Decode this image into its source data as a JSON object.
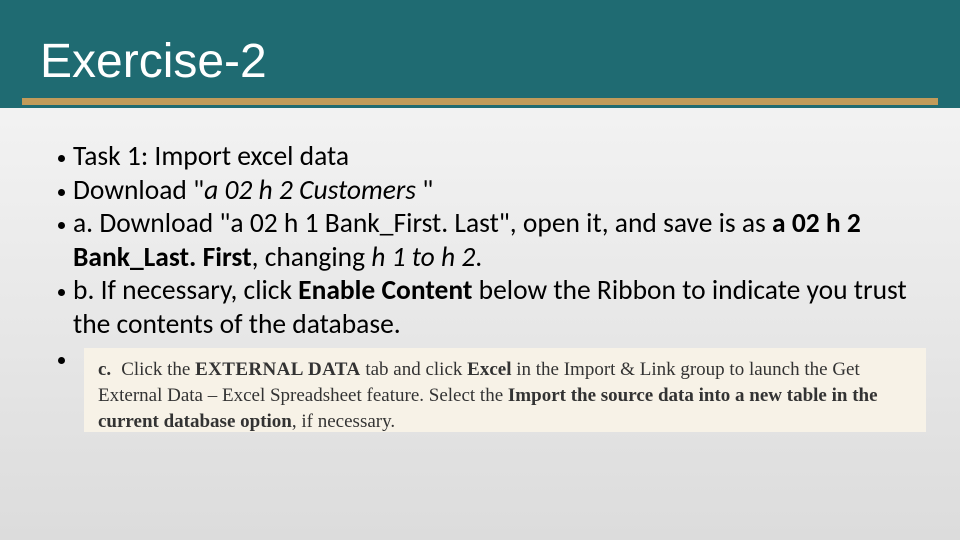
{
  "title": "Exercise-2",
  "bullets": {
    "b1": "Task 1: Import excel data",
    "b2_pre": "Download \"",
    "b2_italic": "a 02 h 2 Customers ",
    "b2_post": "\"",
    "b3_a": "a. Download \"a 02 h 1 Bank_First. Last\", open it, and save is as ",
    "b3_bold": "a 02 h 2 Bank_Last. First",
    "b3_mid": ", changing ",
    "b3_italic": "h 1 to h 2",
    "b3_end": ".",
    "b4_a": "b. If necessary, click ",
    "b4_bold": "Enable Content",
    "b4_b": " below the Ribbon to indicate you trust the contents of the database."
  },
  "embedded": {
    "label": "c.",
    "t1": "Click the ",
    "caps1": "EXTERNAL DATA",
    "t2": " tab and click ",
    "b1": "Excel",
    "t3": " in the Import & Link group to launch the Get External Data – Excel Spreadsheet feature. Select the ",
    "b2": "Import the source data into a new table in the current database option",
    "t4": ", if necessary."
  }
}
